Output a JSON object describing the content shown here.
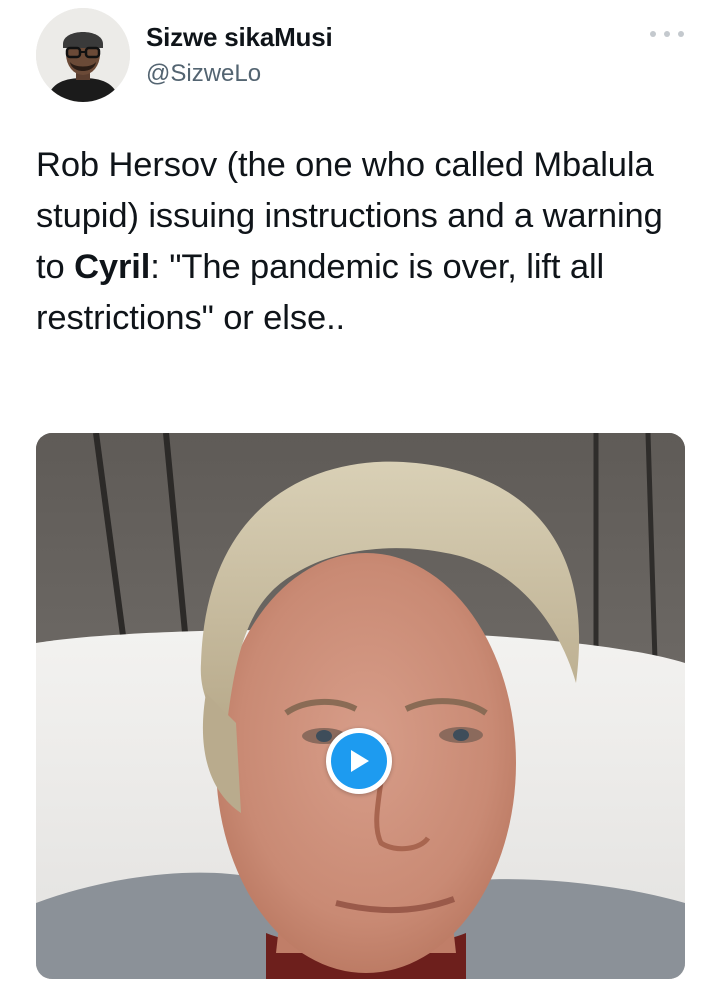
{
  "author": {
    "display_name": "Sizwe sikaMusi",
    "handle": "@SizweLo"
  },
  "tweet": {
    "text_before": "Rob Hersov (the one who called Mbalula stupid) issuing instructions and a warning to ",
    "text_bold": "Cyril",
    "text_after": ": \"The pandemic is over, lift all restrictions\" or else.."
  },
  "media": {
    "type": "video",
    "play_icon": "play-icon"
  },
  "icons": {
    "more": "more-options-icon"
  },
  "colors": {
    "play_accent": "#1d9bf0",
    "handle_gray": "#536471",
    "text": "#0f1419"
  }
}
